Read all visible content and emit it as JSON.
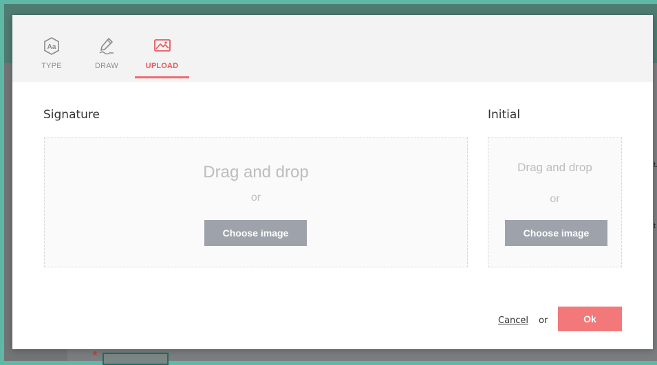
{
  "tabs": [
    {
      "label": "TYPE",
      "icon": "type-icon",
      "active": false
    },
    {
      "label": "DRAW",
      "icon": "pen-icon",
      "active": false
    },
    {
      "label": "UPLOAD",
      "icon": "image-upload-icon",
      "active": true
    }
  ],
  "signature": {
    "title": "Signature",
    "drag_text": "Drag and drop",
    "or_text": "or",
    "button_label": "Choose image"
  },
  "initial": {
    "title": "Initial",
    "drag_text": "Drag and drop",
    "or_text": "or",
    "button_label": "Choose image"
  },
  "footer": {
    "cancel_label": "Cancel",
    "or_text": "or",
    "ok_label": "Ok"
  },
  "background": {
    "required_marker": "*",
    "edge_text_1": "t.",
    "edge_text_2": "t"
  },
  "colors": {
    "accent": "#ef6b6e",
    "ok_button": "#f2787a",
    "choose_button": "#9ea3ab",
    "outer_border": "#5fb8a6"
  }
}
